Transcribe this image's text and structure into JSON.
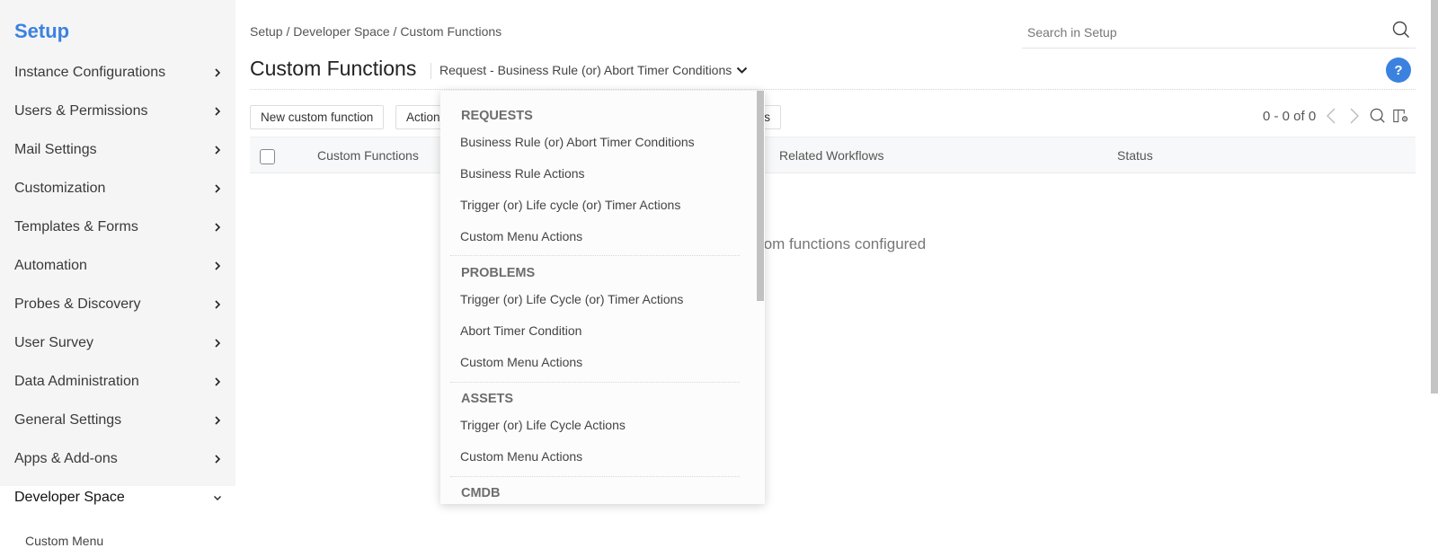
{
  "sidebar": {
    "title": "Setup",
    "items": [
      {
        "label": "Instance Configurations"
      },
      {
        "label": "Users & Permissions"
      },
      {
        "label": "Mail Settings"
      },
      {
        "label": "Customization"
      },
      {
        "label": "Templates & Forms"
      },
      {
        "label": "Automation"
      },
      {
        "label": "Probes & Discovery"
      },
      {
        "label": "User Survey"
      },
      {
        "label": "Data Administration"
      },
      {
        "label": "General Settings"
      },
      {
        "label": "Apps & Add-ons"
      },
      {
        "label": "Developer Space"
      }
    ],
    "sub_item": "Custom Menu"
  },
  "header": {
    "breadcrumb": "Setup / Developer Space / Custom Functions",
    "search_placeholder": "Search in Setup",
    "title": "Custom Functions",
    "filter_selected": "Request - Business Rule (or) Abort Timer Conditions",
    "help_label": "?"
  },
  "toolbar": {
    "new_button": "New custom function",
    "actions_button": "Actions",
    "hidden_button_tail": "s",
    "pagination": "0 - 0 of 0"
  },
  "table": {
    "columns": [
      "Custom Functions",
      "Related Workflows",
      "Status"
    ],
    "empty_message_visible": "tom functions configured"
  },
  "dropdown": {
    "groups": [
      {
        "label": "REQUESTS",
        "items": [
          "Business Rule (or) Abort Timer Conditions",
          "Business Rule Actions",
          "Trigger (or) Life cycle (or) Timer Actions",
          "Custom Menu Actions"
        ]
      },
      {
        "label": "PROBLEMS",
        "items": [
          "Trigger (or) Life Cycle (or) Timer Actions",
          "Abort Timer Condition",
          "Custom Menu Actions"
        ]
      },
      {
        "label": "ASSETS",
        "items": [
          "Trigger (or) Life Cycle Actions",
          "Custom Menu Actions"
        ]
      },
      {
        "label": "CMDB",
        "items": []
      }
    ]
  },
  "colors": {
    "accent": "#3b82e0",
    "sidebar_bg": "#f5f5f5"
  }
}
